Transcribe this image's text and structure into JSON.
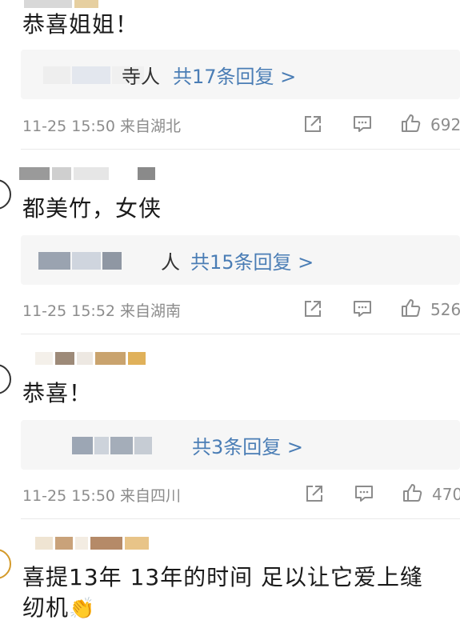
{
  "comments": [
    {
      "text": "恭喜姐姐！",
      "reply_tail": "寺人",
      "reply_count": "共17条回复 >",
      "meta": "11-25 15:50 来自湖北",
      "likes": "692"
    },
    {
      "text": "都美竹，女侠",
      "reply_tail": "人",
      "reply_count": "共15条回复 >",
      "meta": "11-25 15:52 来自湖南",
      "likes": "526"
    },
    {
      "text": "恭喜！",
      "reply_tail": "",
      "reply_count": "共3条回复 >",
      "meta": "11-25 15:50 来自四川",
      "likes": "470"
    },
    {
      "text": "喜提13年 13年的时间 足以让它爱上缝纫机",
      "emoji": "👏"
    }
  ],
  "icons": {
    "share": "share-icon",
    "comment": "comment-icon",
    "like": "thumbs-up-icon"
  },
  "colors": {
    "reply_link": "#4a7db5",
    "meta": "#8c8c8c",
    "reply_bg": "#f6f6f6"
  }
}
